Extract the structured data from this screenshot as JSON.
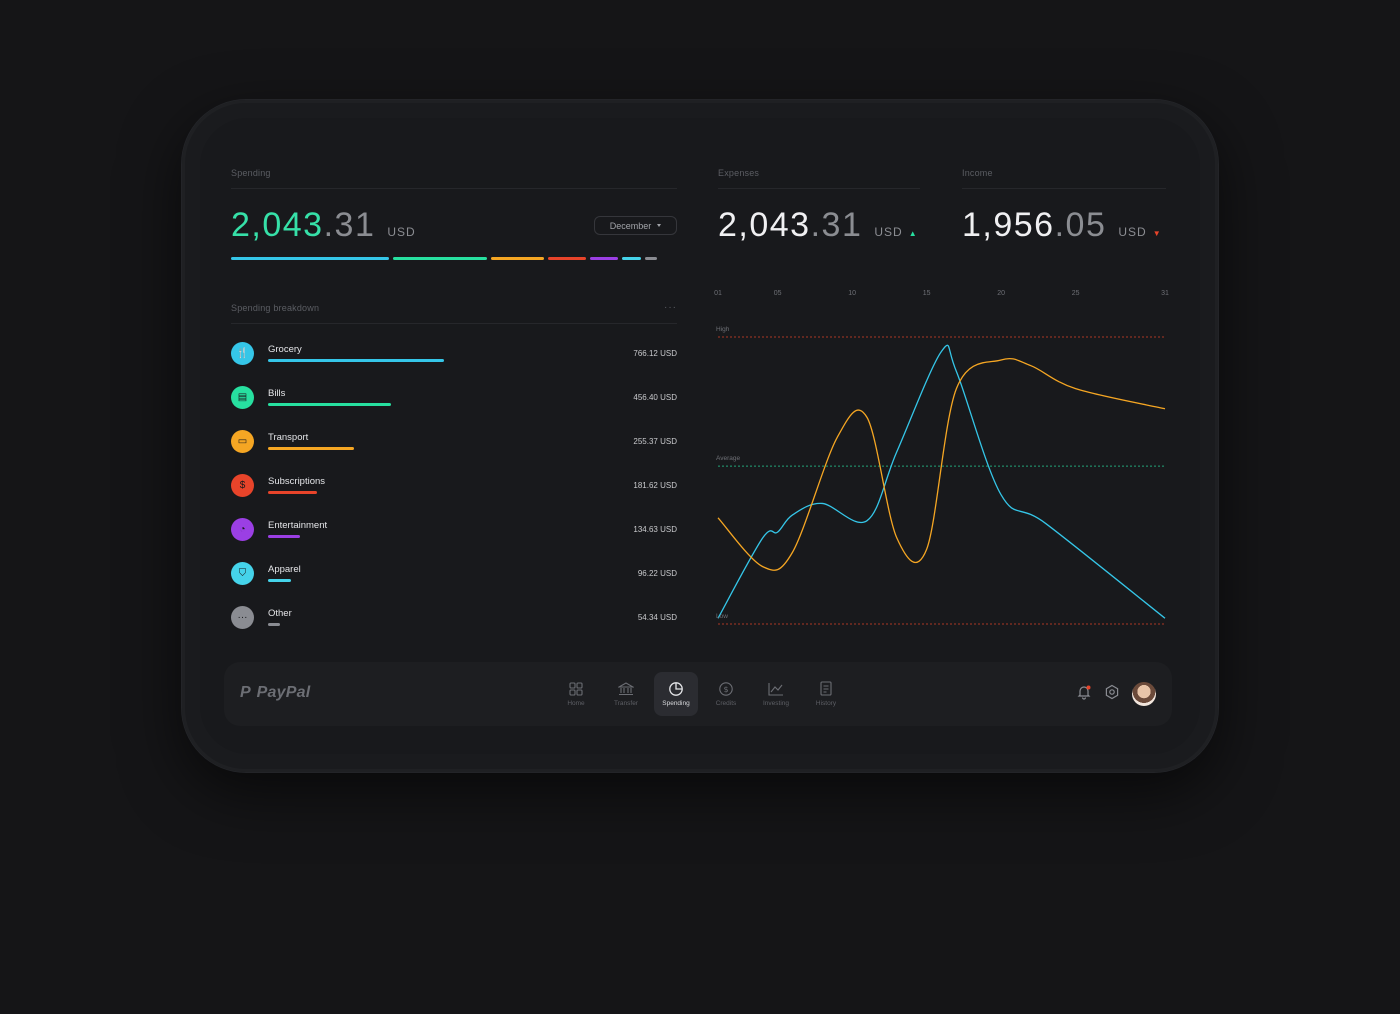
{
  "spending": {
    "label": "Spending",
    "amount_int": "2,043",
    "amount_dec": ".31",
    "currency": "USD",
    "month": "December",
    "segments": [
      {
        "color": "#35c6e8",
        "share": 0.3749
      },
      {
        "color": "#27e0a0",
        "share": 0.2234
      },
      {
        "color": "#f5a623",
        "share": 0.125
      },
      {
        "color": "#e8442a",
        "share": 0.0889
      },
      {
        "color": "#9b3fe4",
        "share": 0.0659
      },
      {
        "color": "#45d3ea",
        "share": 0.0471
      },
      {
        "color": "#8a8c92",
        "share": 0.0265
      }
    ]
  },
  "breakdown": {
    "label": "Spending breakdown",
    "more": "···",
    "items": [
      {
        "name": "Grocery",
        "amount": "766.12 USD",
        "color": "#35c6e8",
        "icon": "fork-knife-icon",
        "glyph": "🍴",
        "bar_share": 1.0
      },
      {
        "name": "Bills",
        "amount": "456.40 USD",
        "color": "#27e0a0",
        "icon": "receipt-icon",
        "glyph": "▤",
        "bar_share": 0.7
      },
      {
        "name": "Transport",
        "amount": "255.37 USD",
        "color": "#f5a623",
        "icon": "car-icon",
        "glyph": "▭",
        "bar_share": 0.49
      },
      {
        "name": "Subscriptions",
        "amount": "181.62 USD",
        "color": "#e8442a",
        "icon": "dollar-icon",
        "glyph": "$",
        "bar_share": 0.28
      },
      {
        "name": "Entertainment",
        "amount": "134.63 USD",
        "color": "#9b3fe4",
        "icon": "pacman-icon",
        "glyph": "◔",
        "bar_share": 0.18
      },
      {
        "name": "Apparel",
        "amount": "96.22 USD",
        "color": "#45d3ea",
        "icon": "shirt-icon",
        "glyph": "⛉",
        "bar_share": 0.13
      },
      {
        "name": "Other",
        "amount": "54.34 USD",
        "color": "#8a8c92",
        "icon": "more-dots-icon",
        "glyph": "···",
        "bar_share": 0.07
      }
    ]
  },
  "expenses": {
    "label": "Expenses",
    "amount_int": "2,043",
    "amount_dec": ".31",
    "currency": "USD",
    "trend": "▲",
    "trend_color": "#27e0a0"
  },
  "income": {
    "label": "Income",
    "amount_int": "1,956",
    "amount_dec": ".05",
    "currency": "USD",
    "trend": "▼",
    "trend_color": "#e8442a"
  },
  "chart_data": {
    "type": "line",
    "x_ticks": [
      "01",
      "05",
      "10",
      "15",
      "20",
      "25",
      "31"
    ],
    "reference_lines": [
      {
        "label": "High",
        "color": "#e8442a"
      },
      {
        "label": "Average",
        "color": "#27e0a0"
      },
      {
        "label": "Low",
        "color": "#e8442a"
      }
    ],
    "series": [
      {
        "color": "#35c6e8",
        "x": [
          1,
          4,
          5,
          6,
          8,
          11,
          13,
          16,
          17,
          20,
          23,
          31
        ],
        "y": [
          0.02,
          0.3,
          0.32,
          0.38,
          0.42,
          0.36,
          0.6,
          0.95,
          0.88,
          0.45,
          0.35,
          0.02
        ]
      },
      {
        "color": "#f5a623",
        "x": [
          1,
          4,
          6,
          9,
          11,
          13,
          15,
          17,
          20,
          22,
          25,
          31
        ],
        "y": [
          0.37,
          0.2,
          0.25,
          0.65,
          0.72,
          0.3,
          0.26,
          0.82,
          0.92,
          0.9,
          0.82,
          0.75
        ]
      }
    ]
  },
  "dock": {
    "brand": "PayPal",
    "nav": [
      {
        "label": "Home",
        "icon": "grid-icon",
        "active": false
      },
      {
        "label": "Transfer",
        "icon": "bank-icon",
        "active": false
      },
      {
        "label": "Spending",
        "icon": "pie-chart-icon",
        "active": true
      },
      {
        "label": "Credits",
        "icon": "coin-icon",
        "active": false
      },
      {
        "label": "Investing",
        "icon": "line-chart-icon",
        "active": false
      },
      {
        "label": "History",
        "icon": "document-icon",
        "active": false
      }
    ]
  }
}
